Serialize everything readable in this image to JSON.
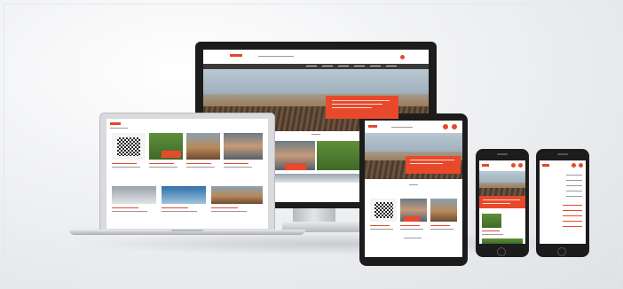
{
  "scene": {
    "subject": "responsive-website-mockup",
    "devices": [
      "desktop-monitor",
      "laptop",
      "tablet",
      "smartphone",
      "smartphone"
    ],
    "accent_color": "#e8492b",
    "bezel_color": "#1c1c1c",
    "background_color": "#eef0f2"
  }
}
